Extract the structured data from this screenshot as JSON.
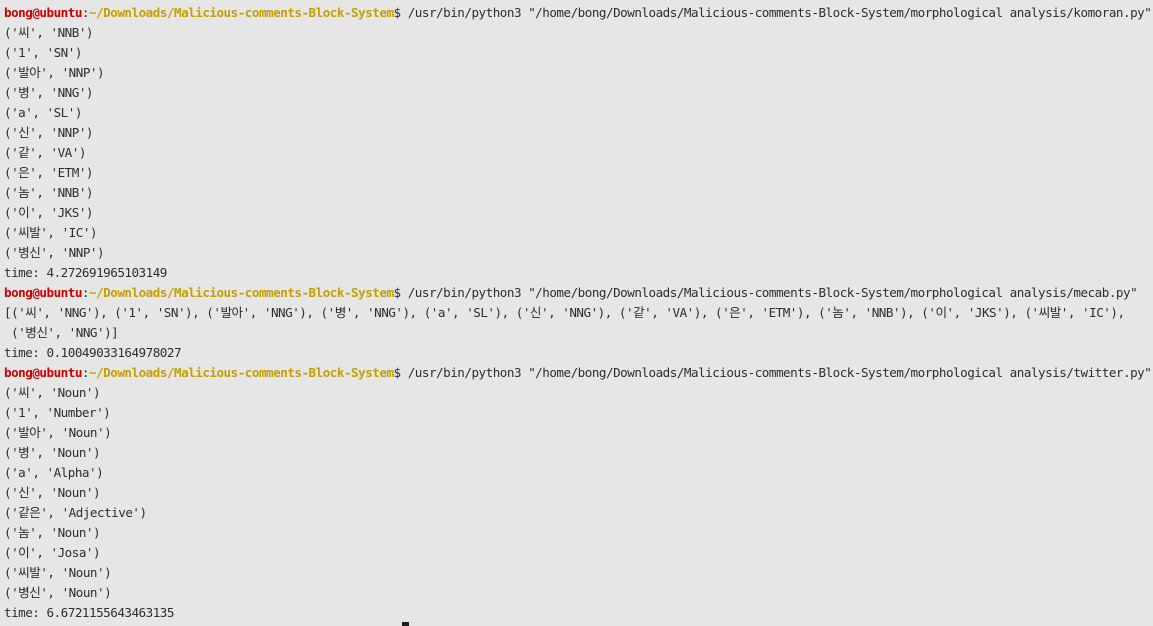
{
  "prompt": {
    "user_host": "bong@ubuntu",
    "colon": ":",
    "path": "~/Downloads/Malicious-comments-Block-System",
    "symbol": "$"
  },
  "colors": {
    "background": "#e6e6e6",
    "text": "#2e2e2e",
    "user_host": "#cc0000",
    "path": "#c4a000"
  },
  "commands": {
    "komoran": " /usr/bin/python3 \"/home/bong/Downloads/Malicious-comments-Block-System/morphological analysis/komoran.py\"",
    "mecab": " /usr/bin/python3 \"/home/bong/Downloads/Malicious-comments-Block-System/morphological analysis/mecab.py\"",
    "twitter": " /usr/bin/python3 \"/home/bong/Downloads/Malicious-comments-Block-System/morphological analysis/twitter.py\""
  },
  "komoran_output": [
    "('씨', 'NNB')",
    "('1', 'SN')",
    "('발아', 'NNP')",
    "('병', 'NNG')",
    "('a', 'SL')",
    "('신', 'NNP')",
    "('같', 'VA')",
    "('은', 'ETM')",
    "('놈', 'NNB')",
    "('이', 'JKS')",
    "('씨발', 'IC')",
    "('병신', 'NNP')",
    "time: 4.272691965103149"
  ],
  "mecab_output": [
    "[('씨', 'NNG'), ('1', 'SN'), ('발아', 'NNG'), ('병', 'NNG'), ('a', 'SL'), ('신', 'NNG'), ('같', 'VA'), ('은', 'ETM'), ('놈', 'NNB'), ('이', 'JKS'), ('씨발', 'IC'),",
    " ('병신', 'NNG')]",
    "time: 0.10049033164978027"
  ],
  "twitter_output": [
    "('씨', 'Noun')",
    "('1', 'Number')",
    "('발아', 'Noun')",
    "('병', 'Noun')",
    "('a', 'Alpha')",
    "('신', 'Noun')",
    "('같은', 'Adjective')",
    "('놈', 'Noun')",
    "('이', 'Josa')",
    "('씨발', 'Noun')",
    "('병신', 'Noun')",
    "time: 6.6721155643463135"
  ]
}
